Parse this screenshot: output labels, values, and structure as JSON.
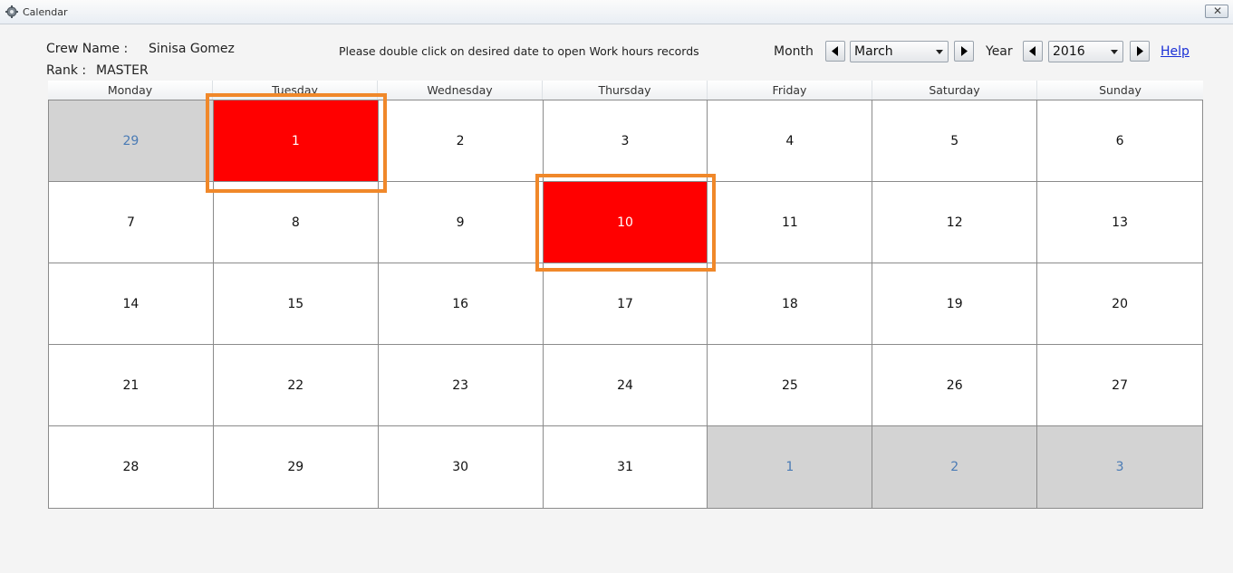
{
  "window": {
    "title": "Calendar",
    "close_glyph": "✕"
  },
  "crew": {
    "name_label": "Crew Name :",
    "name_value": "Sinisa Gomez",
    "rank_label": "Rank :",
    "rank_value": "MASTER"
  },
  "instruction": "Please double click on desired date to open Work hours records",
  "controls": {
    "month_label": "Month",
    "month_value": "March",
    "year_label": "Year",
    "year_value": "2016",
    "help_label": "Help"
  },
  "colors": {
    "flagged_day": "#ff0000",
    "other_month_day": "#d3d3d3",
    "other_month_text": "#4a7bb5",
    "highlight_box": "#f0882a"
  },
  "weekdays": [
    "Monday",
    "Tuesday",
    "Wednesday",
    "Thursday",
    "Friday",
    "Saturday",
    "Sunday"
  ],
  "weeks": [
    [
      {
        "day": "29",
        "state": "other"
      },
      {
        "day": "1",
        "state": "flag"
      },
      {
        "day": "2",
        "state": "normal"
      },
      {
        "day": "3",
        "state": "normal"
      },
      {
        "day": "4",
        "state": "normal"
      },
      {
        "day": "5",
        "state": "normal"
      },
      {
        "day": "6",
        "state": "normal"
      }
    ],
    [
      {
        "day": "7",
        "state": "normal"
      },
      {
        "day": "8",
        "state": "normal"
      },
      {
        "day": "9",
        "state": "normal"
      },
      {
        "day": "10",
        "state": "flag"
      },
      {
        "day": "11",
        "state": "normal"
      },
      {
        "day": "12",
        "state": "normal"
      },
      {
        "day": "13",
        "state": "normal"
      }
    ],
    [
      {
        "day": "14",
        "state": "normal"
      },
      {
        "day": "15",
        "state": "normal"
      },
      {
        "day": "16",
        "state": "normal"
      },
      {
        "day": "17",
        "state": "normal"
      },
      {
        "day": "18",
        "state": "normal"
      },
      {
        "day": "19",
        "state": "normal"
      },
      {
        "day": "20",
        "state": "normal"
      }
    ],
    [
      {
        "day": "21",
        "state": "normal"
      },
      {
        "day": "22",
        "state": "normal"
      },
      {
        "day": "23",
        "state": "normal"
      },
      {
        "day": "24",
        "state": "normal"
      },
      {
        "day": "25",
        "state": "normal"
      },
      {
        "day": "26",
        "state": "normal"
      },
      {
        "day": "27",
        "state": "normal"
      }
    ],
    [
      {
        "day": "28",
        "state": "normal"
      },
      {
        "day": "29",
        "state": "normal"
      },
      {
        "day": "30",
        "state": "normal"
      },
      {
        "day": "31",
        "state": "normal"
      },
      {
        "day": "1",
        "state": "other"
      },
      {
        "day": "2",
        "state": "other"
      },
      {
        "day": "3",
        "state": "other"
      }
    ]
  ]
}
